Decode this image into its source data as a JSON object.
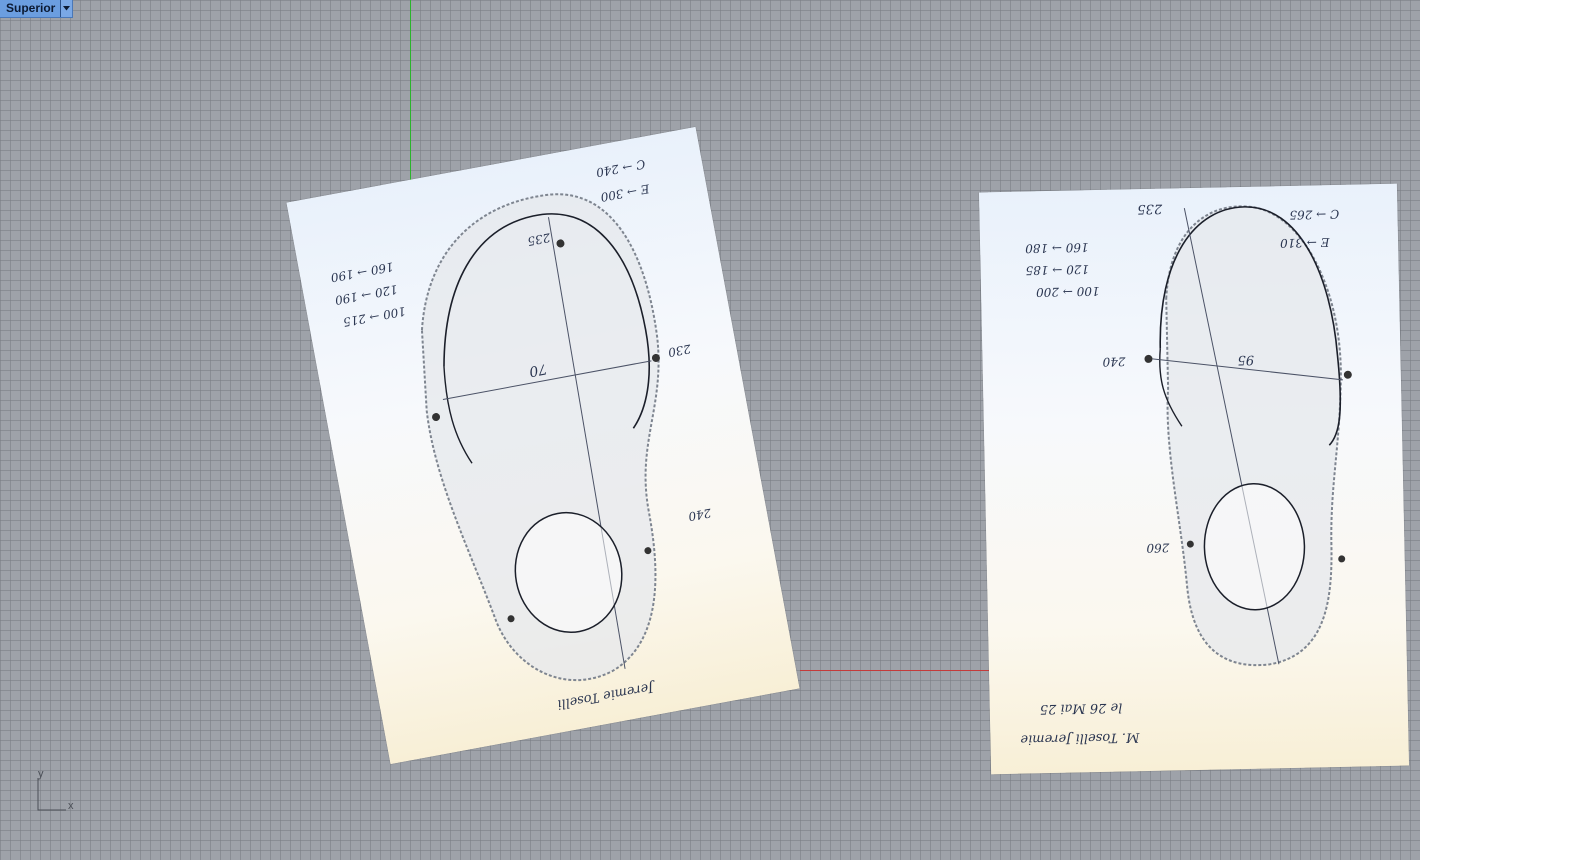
{
  "viewport": {
    "name": "Superior",
    "dropdown_icon": "chevron-down-icon"
  },
  "colors": {
    "background": "#9ea2a9",
    "grid": "#787c84",
    "tab": "#6b9ee0",
    "y_axis": "#2bb52b",
    "x_axis": "#c43b3b"
  },
  "axis_indicator": {
    "y_label": "y",
    "x_label": "x"
  },
  "sheets": [
    {
      "image": "foot-scan-left",
      "notes": {
        "c_line": "C → 240",
        "e_line": "E → 300",
        "l1": "160 → 190",
        "l2": "120 → 190",
        "l3": "100 → 215",
        "top": "235",
        "mid": "70",
        "right_mid": "230",
        "right_low": "240",
        "signature": "Jeremie Toselli"
      }
    },
    {
      "image": "foot-scan-right",
      "notes": {
        "c_line": "C → 265",
        "e_line": "E → 310",
        "l1": "160 → 180",
        "l2": "120 → 185",
        "l3": "100 → 200",
        "top": "235",
        "mid": "95",
        "left_mid": "240",
        "left_low": "260",
        "signature": "M. Toselli Jeremie",
        "date": "le 26 Mai 25"
      }
    }
  ]
}
